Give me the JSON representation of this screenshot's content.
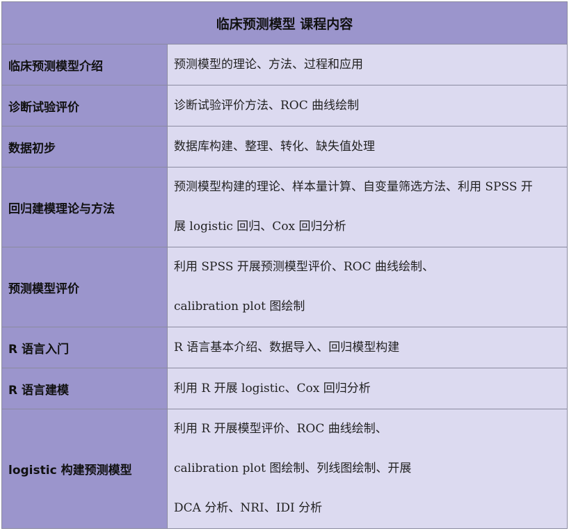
{
  "table": {
    "title": "临床预测模型  课程内容",
    "rows": [
      {
        "topic": "临床预测模型介绍",
        "content": [
          "预测模型的理论、方法、过程和应用"
        ]
      },
      {
        "topic": "诊断试验评价",
        "content": [
          "诊断试验评价方法、ROC 曲线绘制"
        ]
      },
      {
        "topic": "数据初步",
        "content": [
          "数据库构建、整理、转化、缺失值处理"
        ]
      },
      {
        "topic": "回归建模理论与方法",
        "content": [
          "预测模型构建的理论、样本量计算、自变量筛选方法、利用 SPSS 开",
          "展 logistic 回归、Cox 回归分析"
        ]
      },
      {
        "topic": "预测模型评价",
        "content": [
          "利用 SPSS 开展预测模型评价、ROC 曲线绘制、",
          "calibration plot 图绘制"
        ]
      },
      {
        "topic": "R 语言入门",
        "content": [
          "R 语言基本介绍、数据导入、回归模型构建"
        ]
      },
      {
        "topic": "R 语言建模",
        "content": [
          "利用 R 开展 logistic、Cox 回归分析"
        ]
      },
      {
        "topic": "logistic 构建预测模型",
        "content": [
          "利用 R 开展模型评价、ROC 曲线绘制、",
          "calibration plot 图绘制、列线图绘制、开展",
          "DCA 分析、NRI、IDI 分析"
        ]
      }
    ]
  }
}
